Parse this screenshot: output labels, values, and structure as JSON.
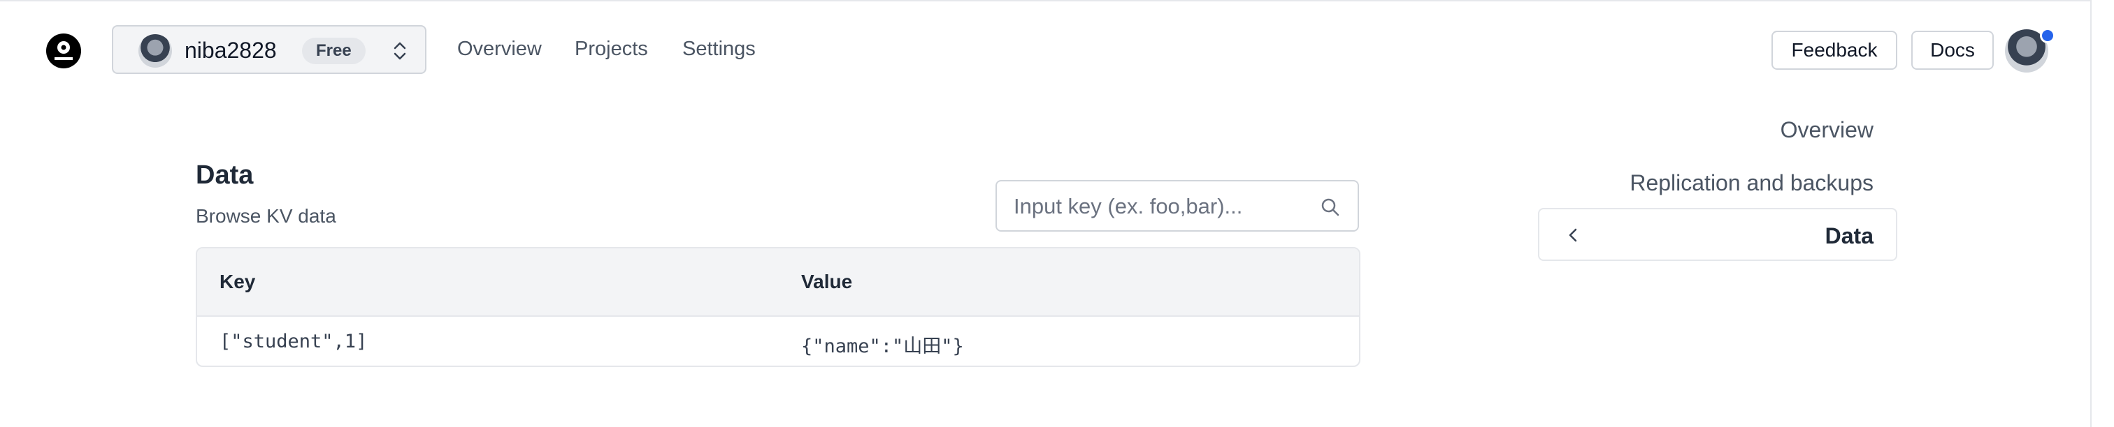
{
  "header": {
    "team": {
      "name": "niba2828",
      "plan": "Free"
    },
    "nav": [
      {
        "label": "Overview"
      },
      {
        "label": "Projects"
      },
      {
        "label": "Settings"
      }
    ],
    "buttons": {
      "feedback": "Feedback",
      "docs": "Docs"
    }
  },
  "page": {
    "title": "Data",
    "subtitle": "Browse KV data",
    "search": {
      "placeholder": "Input key (ex. foo,bar)...",
      "value": ""
    }
  },
  "table": {
    "columns": [
      "Key",
      "Value"
    ],
    "rows": [
      {
        "key": "[\"student\",1]",
        "value": "{\"name\":\"山田\"}"
      }
    ]
  },
  "sidebar": {
    "items": [
      {
        "label": "Overview"
      },
      {
        "label": "Replication and backups"
      },
      {
        "label": "Data"
      }
    ]
  },
  "colors": {
    "accent": "#2563eb",
    "border": "#d1d5db",
    "header_bg": "#f3f4f6"
  },
  "icons": [
    "logo-icon",
    "chevron-up-down-icon",
    "search-icon",
    "chevron-left-icon"
  ]
}
